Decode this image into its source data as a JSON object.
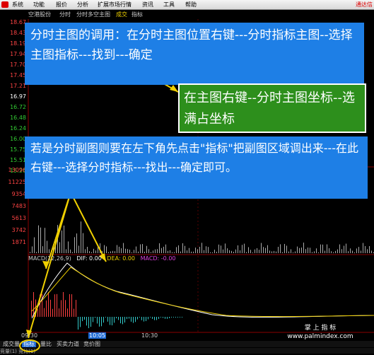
{
  "menu": {
    "items": [
      "系统",
      "功能",
      "报价",
      "分析",
      "扩展市场行情",
      "资讯",
      "工具",
      "帮助"
    ],
    "right": "通达信"
  },
  "subbar": {
    "items": [
      "空港股份",
      "分时",
      "分时多空主图",
      "成交",
      "指标"
    ]
  },
  "price_axis": [
    {
      "v": "18.67",
      "c": "red"
    },
    {
      "v": "18.43",
      "c": "red"
    },
    {
      "v": "18.19",
      "c": "red"
    },
    {
      "v": "17.94",
      "c": "red"
    },
    {
      "v": "17.70",
      "c": "red"
    },
    {
      "v": "17.45",
      "c": "red"
    },
    {
      "v": "17.21",
      "c": "red"
    },
    {
      "v": "16.97",
      "c": "white"
    },
    {
      "v": "16.72",
      "c": "green"
    },
    {
      "v": "16.48",
      "c": "green"
    },
    {
      "v": "16.24",
      "c": "green"
    },
    {
      "v": "16.00",
      "c": "green"
    },
    {
      "v": "15.75",
      "c": "green"
    },
    {
      "v": "15.51",
      "c": "green"
    },
    {
      "v": "15.26",
      "c": "green"
    }
  ],
  "volume_axis": [
    "13096",
    "11225",
    "9354",
    "7483",
    "5613",
    "3742",
    "1871"
  ],
  "callouts": {
    "main": "分时主图的调用：在分时主图位置右键---分时指标主图--选择主图指标---找到---确定",
    "green": "在主图右键--分时主图坐标--选满占坐标",
    "sub": "若是分时副图则要在左下角先点击\"指标\"把副图区域调出来---在此右键---选择分时指标---找出---确定即可。"
  },
  "macd": {
    "name": "MACD(12,26,9)",
    "dif": "DIF: 0.00",
    "dea": "DEA: 0.00",
    "macd": "MACD: -0.00"
  },
  "times": [
    "09:30",
    "10:05",
    "10:30"
  ],
  "tabs": [
    "成交量",
    "指标",
    "量比",
    "买卖力道",
    "竞价图"
  ],
  "tabs2": "竞量(1)  竞比(1)",
  "watermark": {
    "line1": "掌 上 指 标",
    "line2": "www.palmindex.com"
  },
  "colors": {
    "callout_blue": "#1e7fe6",
    "callout_green": "#2d8f1c",
    "arrow": "#f0d000"
  }
}
